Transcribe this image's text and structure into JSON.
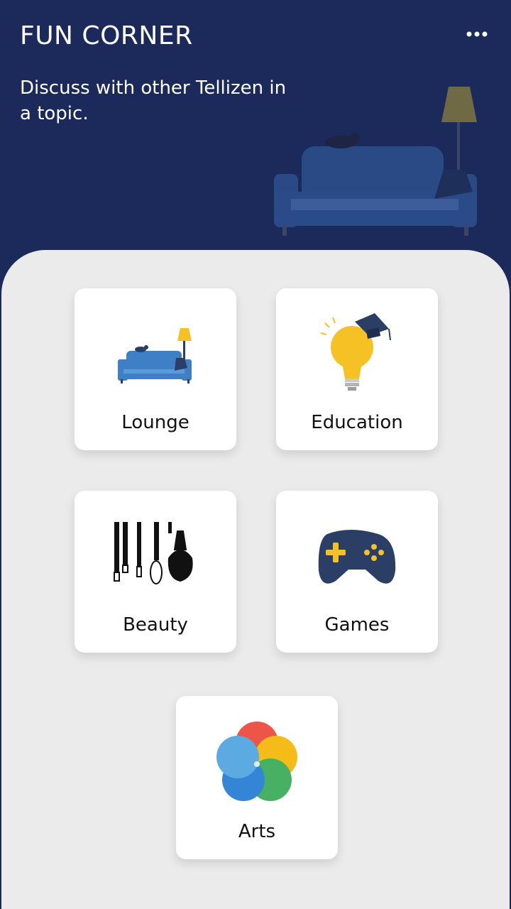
{
  "header": {
    "title": "FUN CORNER",
    "subtitle": "Discuss with other Tellizen in a topic.",
    "more_icon": "more-horizontal-icon"
  },
  "colors": {
    "header_bg": "#1b2a5b",
    "panel_bg": "#ebebeb",
    "card_bg": "#ffffff",
    "sofa_blue": "#3f7fc5",
    "bulb_yellow": "#f5c125",
    "gamepad_navy": "#2b3f66"
  },
  "topics": [
    {
      "label": "Lounge",
      "icon": "sofa-icon"
    },
    {
      "label": "Education",
      "icon": "lightbulb-graduation-cap-icon"
    },
    {
      "label": "Beauty",
      "icon": "makeup-brushes-icon"
    },
    {
      "label": "Games",
      "icon": "gamepad-icon"
    },
    {
      "label": "Arts",
      "icon": "color-petals-icon"
    }
  ]
}
